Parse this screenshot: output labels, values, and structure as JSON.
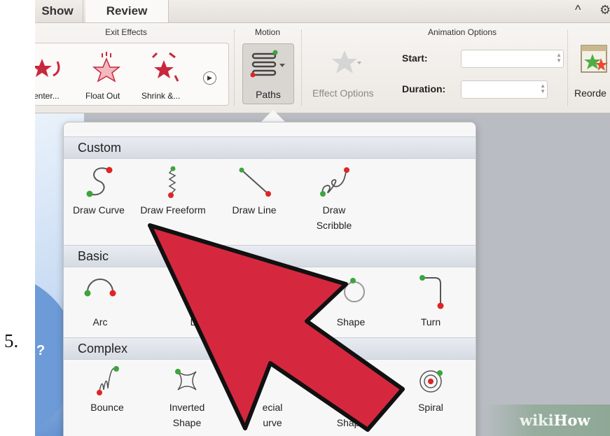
{
  "step_number": "5.",
  "tabs": [
    {
      "label": "Show"
    },
    {
      "label": "Review"
    }
  ],
  "ribbon": {
    "groups": {
      "exit_effects": "Exit Effects",
      "motion": "Motion",
      "animation_options": "Animation Options"
    },
    "exit_effects": [
      {
        "label": "enter..."
      },
      {
        "label": "Float Out"
      },
      {
        "label": "Shrink &..."
      }
    ],
    "paths_label": "Paths",
    "effect_options_label": "Effect Options",
    "start_label": "Start:",
    "start_value": "",
    "duration_label": "Duration:",
    "duration_value": "",
    "reorder_label": "Reorde"
  },
  "motion_paths": {
    "custom": {
      "title": "Custom",
      "items": [
        {
          "label": "Draw Curve",
          "icon": "draw-curve-icon"
        },
        {
          "label": "Draw Freeform",
          "icon": "draw-freeform-icon"
        },
        {
          "label": "Draw Line",
          "icon": "draw-line-icon"
        },
        {
          "label": "Draw Scribble",
          "icon": "draw-scribble-icon"
        }
      ]
    },
    "basic": {
      "title": "Basic",
      "items": [
        {
          "label": "Arc",
          "icon": "arc-icon"
        },
        {
          "label": "Lin",
          "icon": "lines-icon"
        },
        {
          "label": "Shape",
          "icon": "shape-icon"
        },
        {
          "label": "Turn",
          "icon": "turn-icon"
        }
      ]
    },
    "complex": {
      "title": "Complex",
      "items": [
        {
          "label": "Bounce",
          "icon": "bounce-icon"
        },
        {
          "label": "Inverted Shape",
          "icon": "inverted-shape-icon"
        },
        {
          "label": "ecial urve",
          "icon": "special-curve-icon"
        },
        {
          "label": "S Shape",
          "icon": "special-shape-icon"
        },
        {
          "label": "Spiral",
          "icon": "spiral-icon"
        }
      ]
    }
  },
  "watermark": {
    "wiki": "wiki",
    "how": "How"
  },
  "colors": {
    "arrow_red": "#d5283f",
    "path_start": "#3ca53c",
    "path_end": "#e02424",
    "section_header": "#dde2ea"
  }
}
